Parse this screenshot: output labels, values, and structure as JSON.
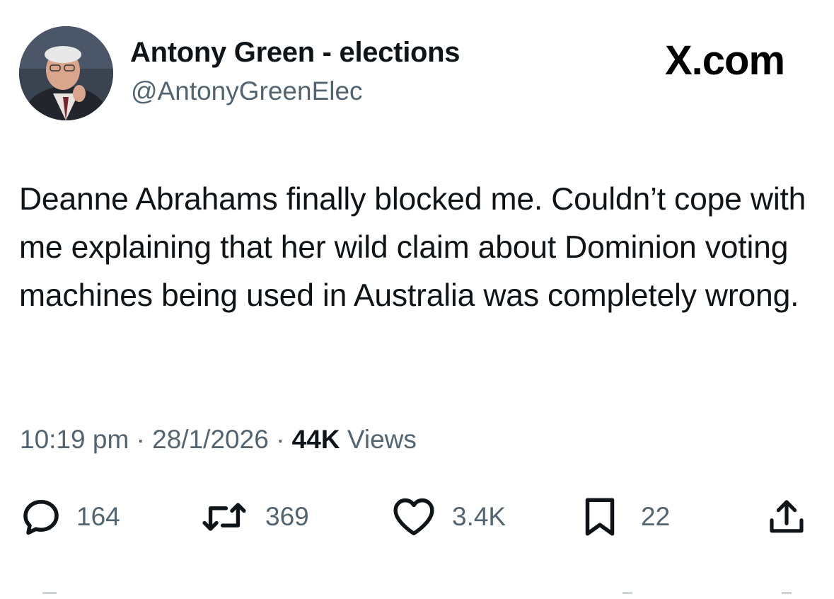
{
  "author": {
    "display_name": "Antony Green - elections",
    "handle": "@AntonyGreenElec",
    "avatar_icon": "profile-photo"
  },
  "brand": "X.com",
  "tweet": {
    "text": "Deanne Abrahams finally blocked me. Couldn’t cope with me explaining that her wild claim about Dominion voting machines being used in Australia was completely wrong."
  },
  "meta": {
    "time": "10:19 pm",
    "separator": "·",
    "date": "28/1/2026",
    "views_count": "44K",
    "views_label": "Views"
  },
  "actions": {
    "replies": {
      "icon": "reply-icon",
      "count": "164"
    },
    "reposts": {
      "icon": "repost-icon",
      "count": "369"
    },
    "likes": {
      "icon": "heart-icon",
      "count": "3.4K"
    },
    "bookmarks": {
      "icon": "bookmark-icon",
      "count": "22"
    },
    "share": {
      "icon": "share-icon"
    }
  },
  "colors": {
    "text_primary": "#0f1419",
    "text_secondary": "#536471",
    "background": "#ffffff"
  }
}
